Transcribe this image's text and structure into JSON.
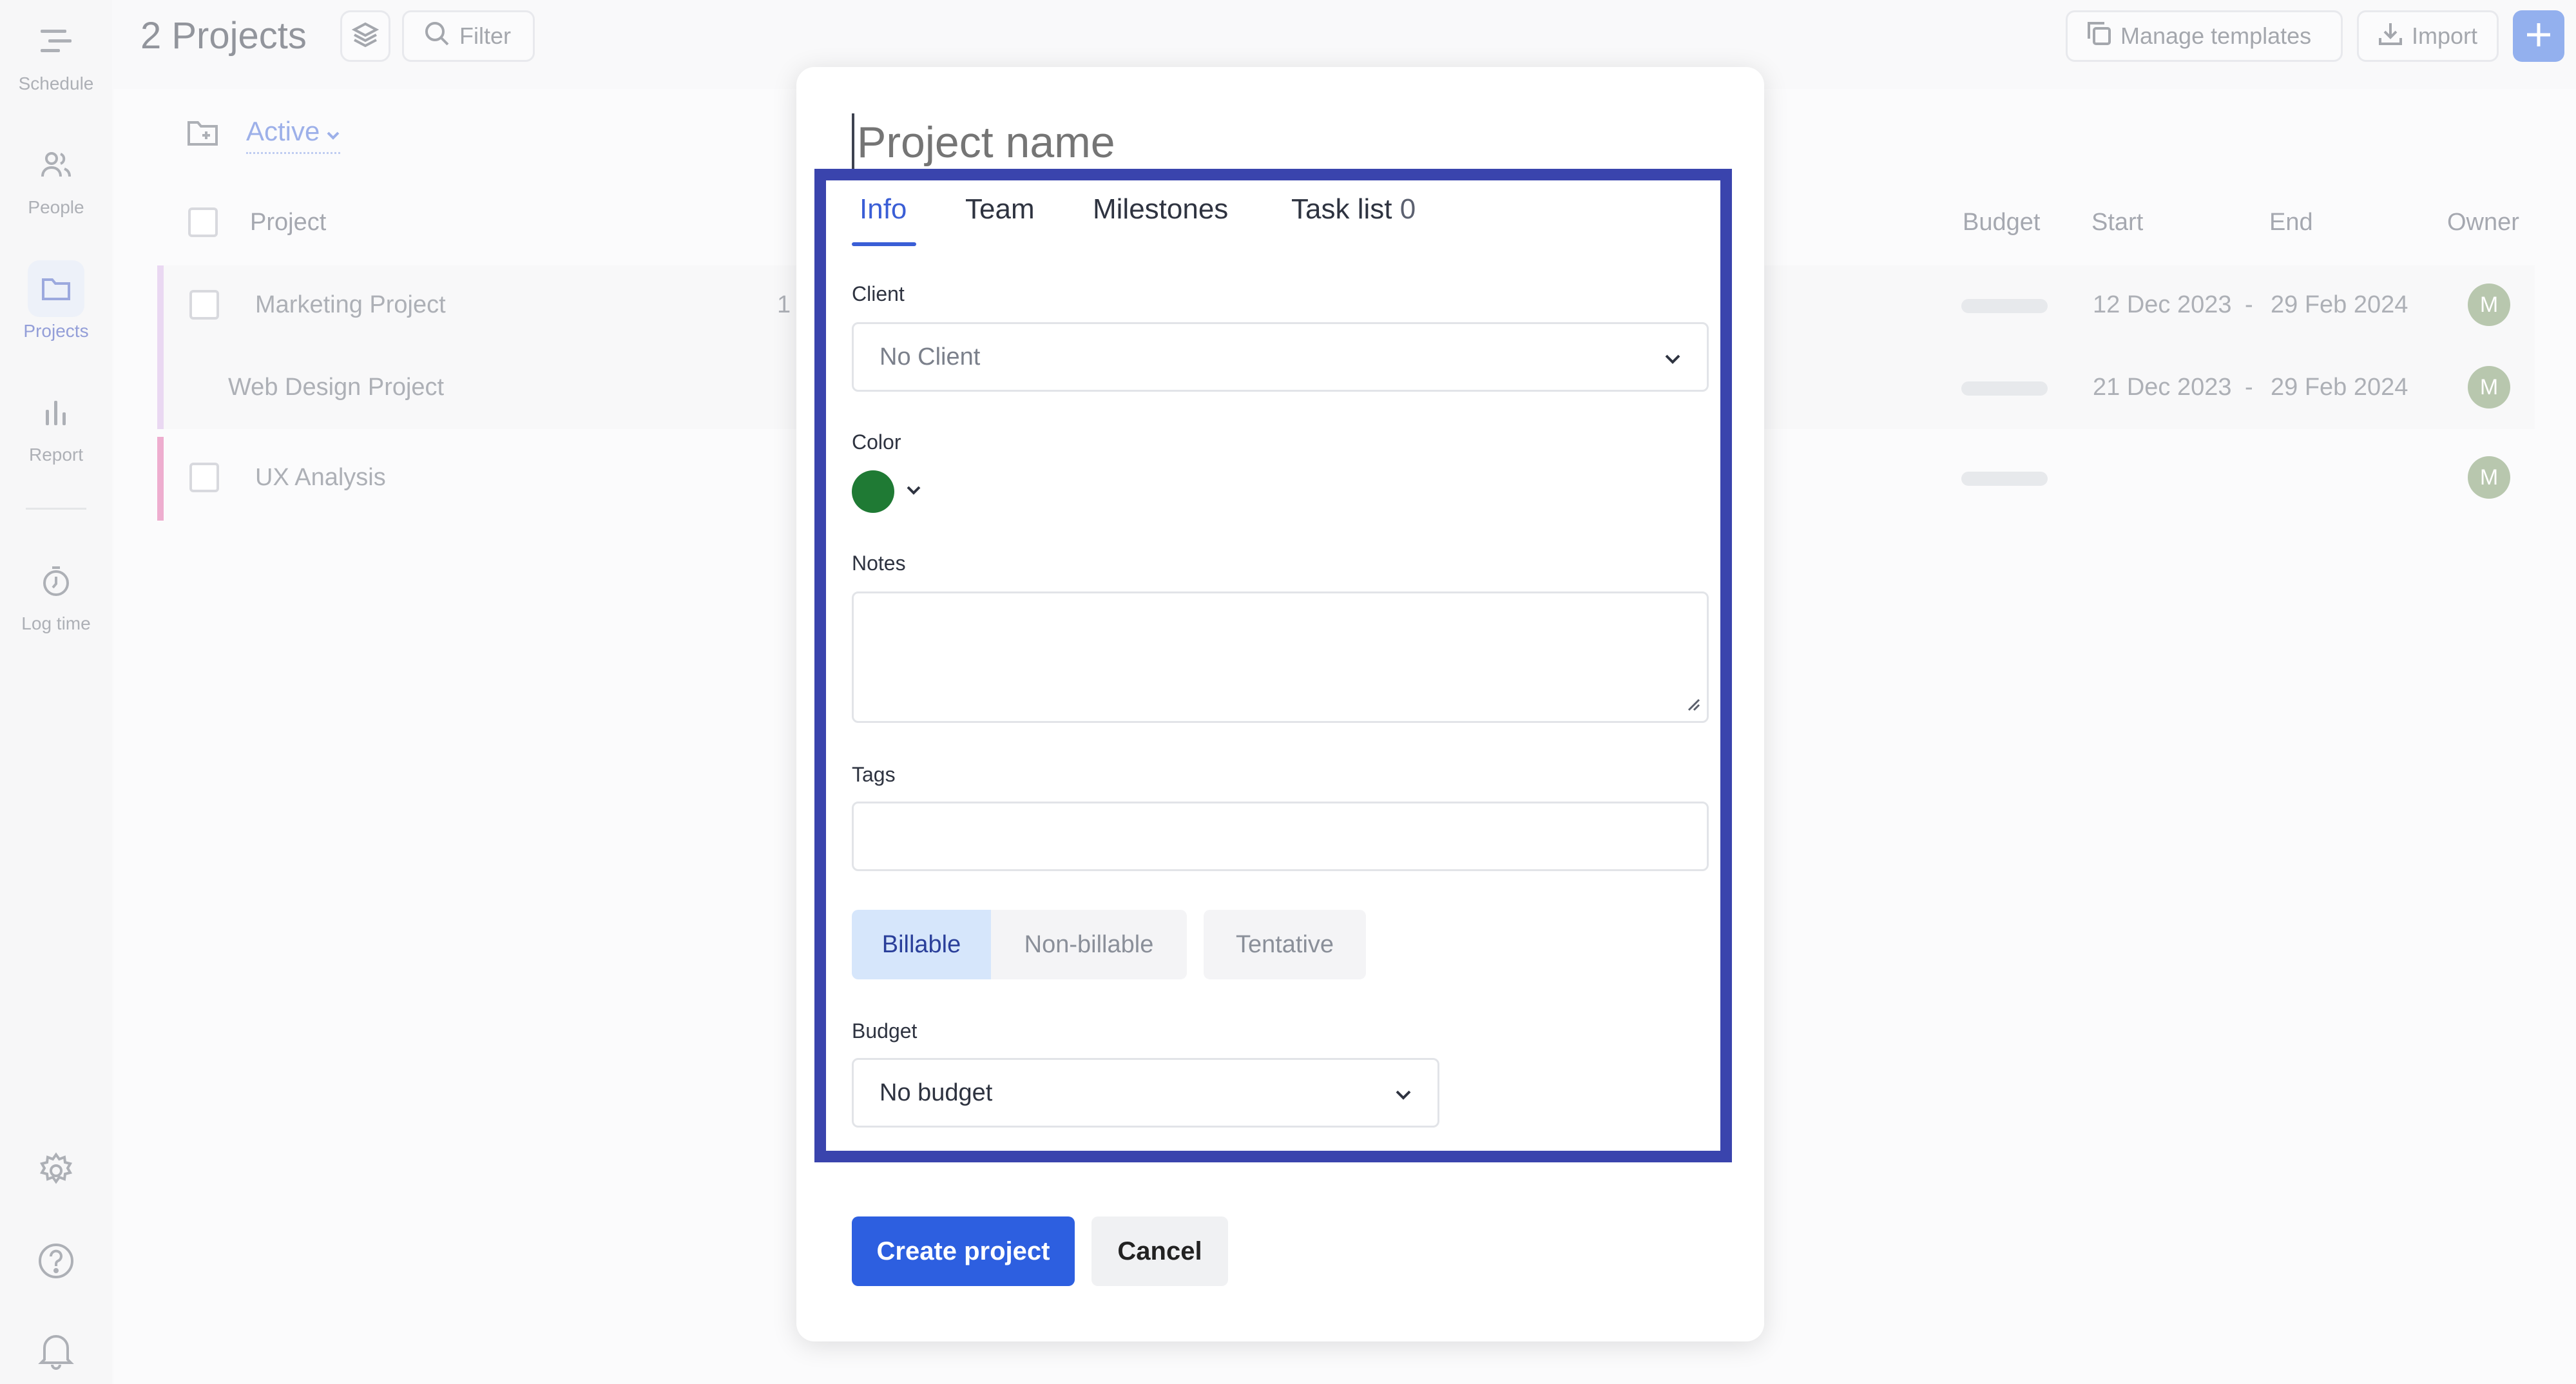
{
  "sidebar": {
    "items": [
      {
        "label": "Schedule",
        "icon": "schedule-icon"
      },
      {
        "label": "People",
        "icon": "people-icon"
      },
      {
        "label": "Projects",
        "icon": "folder-icon",
        "active": true
      },
      {
        "label": "Report",
        "icon": "bar-chart-icon"
      },
      {
        "label": "Log time",
        "icon": "timer-icon"
      }
    ],
    "bottom_icons": [
      "gear-icon",
      "help-icon",
      "bell-icon"
    ]
  },
  "header": {
    "title": "2 Projects",
    "filter_label": "Filter",
    "manage_templates_label": "Manage templates",
    "import_label": "Import"
  },
  "list": {
    "status_filter": "Active",
    "columns": {
      "project": "Project",
      "budget": "Budget",
      "start": "Start",
      "end": "End",
      "owner": "Owner"
    },
    "rows": [
      {
        "name": "Marketing Project",
        "count": "1",
        "start": "12 Dec 2023",
        "dash": "-",
        "end": "29 Feb 2024",
        "owner": "M",
        "color": "#d9b8e8"
      },
      {
        "name": "Web Design Project",
        "start": "21 Dec 2023",
        "dash": "-",
        "end": "29 Feb 2024",
        "owner": "M",
        "color": "#d9b8e8"
      },
      {
        "name": "UX Analysis",
        "owner": "M",
        "color": "#e06aa8"
      }
    ]
  },
  "modal": {
    "name_placeholder": "Project name",
    "tabs": [
      {
        "label": "Info",
        "active": true
      },
      {
        "label": "Team"
      },
      {
        "label": "Milestones"
      },
      {
        "label": "Task list",
        "count": "0"
      }
    ],
    "client_label": "Client",
    "client_value": "No Client",
    "color_label": "Color",
    "color_value": "#1f7a34",
    "notes_label": "Notes",
    "tags_label": "Tags",
    "billing_options": [
      "Billable",
      "Non-billable",
      "Tentative"
    ],
    "billing_selected": "Billable",
    "budget_label": "Budget",
    "budget_value": "No budget",
    "create_label": "Create project",
    "cancel_label": "Cancel"
  }
}
